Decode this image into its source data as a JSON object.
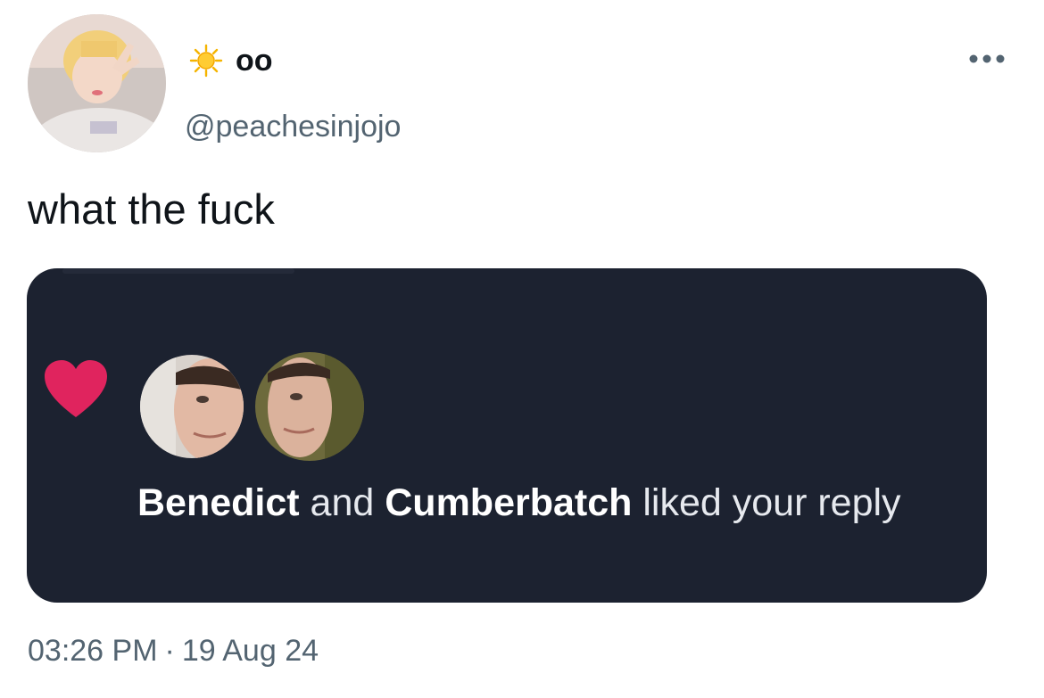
{
  "user": {
    "display_name": "oo",
    "name_emoji": "sun-icon",
    "handle": "@peachesinjojo"
  },
  "tweet": {
    "text": "what the fuck",
    "time": "03:26 PM",
    "separator": "·",
    "date": "19 Aug 24"
  },
  "media": {
    "notification": {
      "name1": "Benedict",
      "connector": " and ",
      "name2": "Cumberbatch",
      "suffix": " liked your reply"
    },
    "heart_color": "#e0245e",
    "background": "#1c2230"
  },
  "icons": {
    "more": "more-horizontal-icon",
    "heart": "heart-icon"
  }
}
